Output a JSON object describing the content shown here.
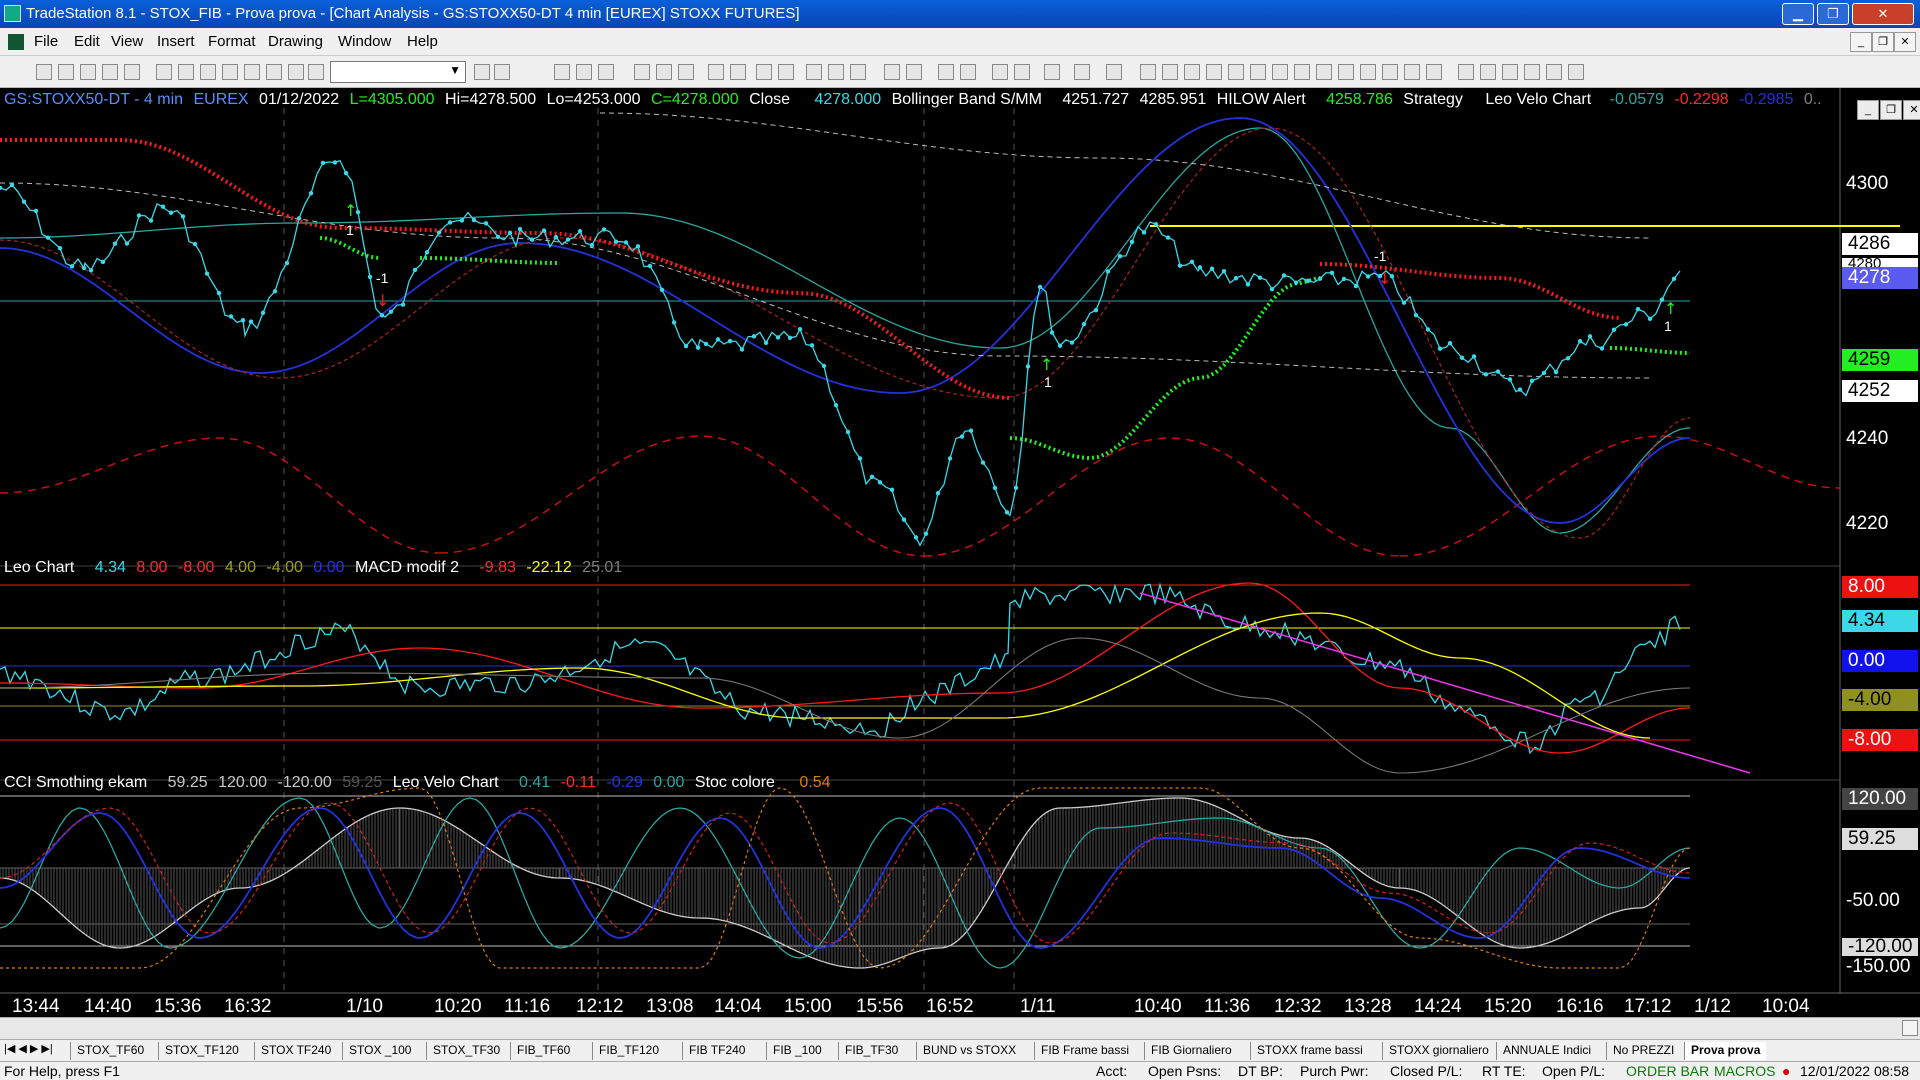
{
  "window": {
    "title": "TradeStation 8.1 - STOX_FIB - Prova prova - [Chart Analysis - GS:STOXX50-DT  4 min  [EUREX] STOXX FUTURES]",
    "minimize": "▁",
    "restore": "❐",
    "close": "✕"
  },
  "menu": [
    "File",
    "Edit",
    "View",
    "Insert",
    "Format",
    "Drawing",
    "Window",
    "Help"
  ],
  "chart_header": {
    "symbol": "GS:STOXX50-DT - 4 min",
    "exchange": "EUREX",
    "date": "01/12/2022",
    "L": "L=4305.000",
    "Hi": "Hi=4278.500",
    "Lo": "Lo=4253.000",
    "C": "C=4278.000",
    "close_label": "Close",
    "close_val": "4278.000",
    "boll_label": "Bollinger Band S/MM",
    "boll_a": "4251.727",
    "boll_b": "4285.951",
    "hilow_label": "HILOW Alert",
    "hilow_val": "4258.786",
    "strat_label": "Strategy",
    "velo_label": "Leo Velo Chart",
    "velo_a": "-0.0579",
    "velo_b": "-0.2298",
    "velo_c": "-0.2985",
    "velo_d": "0.."
  },
  "panel2_header": {
    "name": "Leo Chart",
    "v1": "4.34",
    "v2": "8.00",
    "v3": "-8.00",
    "v4": "4.00",
    "v5": "-4.00",
    "v6": "0.00",
    "macd": "MACD modif 2",
    "m1": "-9.83",
    "m2": "-22.12",
    "m3": "25.01"
  },
  "panel3_header": {
    "name": "CCI Smothing ekam",
    "c1": "59.25",
    "c2": "120.00",
    "c3": "-120.00",
    "c4": "59.25",
    "velo": "Leo Velo Chart",
    "l1": "0.41",
    "l2": "-0.11",
    "l3": "-0.29",
    "l4": "0.00",
    "stoc": "Stoc colore",
    "s1": "0.54"
  },
  "price_axis": [
    "4300",
    "4240",
    "4220"
  ],
  "price_boxes": {
    "b4286": "4286",
    "b4278": "4278",
    "b4259": "4259",
    "b4252": "4252",
    "b4280": "4280"
  },
  "leo_axis": {
    "p8": "8.00",
    "v434": "4.34",
    "z": "0.00",
    "m4": "-4.00",
    "m8": "-8.00"
  },
  "cci_axis": {
    "p120": "120.00",
    "v5925": "59.25",
    "m50": "-50.00",
    "m120": "-120.00",
    "m150": "-150.00"
  },
  "signals": {
    "s1": "1",
    "s2": "-1",
    "s3": "1",
    "s4": "-1",
    "s5": "1"
  },
  "time_axis": [
    "13:44",
    "14:40",
    "15:36",
    "16:32",
    "1/10",
    "10:20",
    "11:16",
    "12:12",
    "13:08",
    "14:04",
    "15:00",
    "15:56",
    "16:52",
    "1/11",
    "10:40",
    "11:36",
    "12:32",
    "13:28",
    "14:24",
    "15:20",
    "16:16",
    "17:12",
    "1/12",
    "10:04"
  ],
  "tabs": [
    "STOX_TF60",
    "STOX_TF120",
    "STOX TF240",
    "STOX _100",
    "STOX_TF30",
    "FIB_TF60",
    "FIB_TF120",
    "FIB TF240",
    "FIB _100",
    "FIB_TF30",
    "BUND vs STOXX",
    "FIB Frame bassi",
    "FIB Giornaliero",
    "STOXX frame bassi",
    "STOXX giornaliero",
    "ANNUALE Indici",
    "No PREZZI",
    "Prova prova"
  ],
  "status": {
    "help": "For Help, press F1",
    "acct": "Acct:",
    "open_psns": "Open Psns:",
    "dt_bp": "DT BP:",
    "purch": "Purch Pwr:",
    "closed": "Closed P/L:",
    "rt_te": "RT TE:",
    "open_pl": "Open P/L:",
    "order_bar": "ORDER BAR",
    "macros": "MACROS",
    "datetime": "12/01/2022 08:58"
  },
  "colors": {
    "cyan": "#3ad8e8",
    "red": "#ff1a1a",
    "green": "#22ee22",
    "yellow": "#ffff00",
    "blue": "#2233dd",
    "teal": "#2aa6a0",
    "magenta": "#ee33ee"
  }
}
